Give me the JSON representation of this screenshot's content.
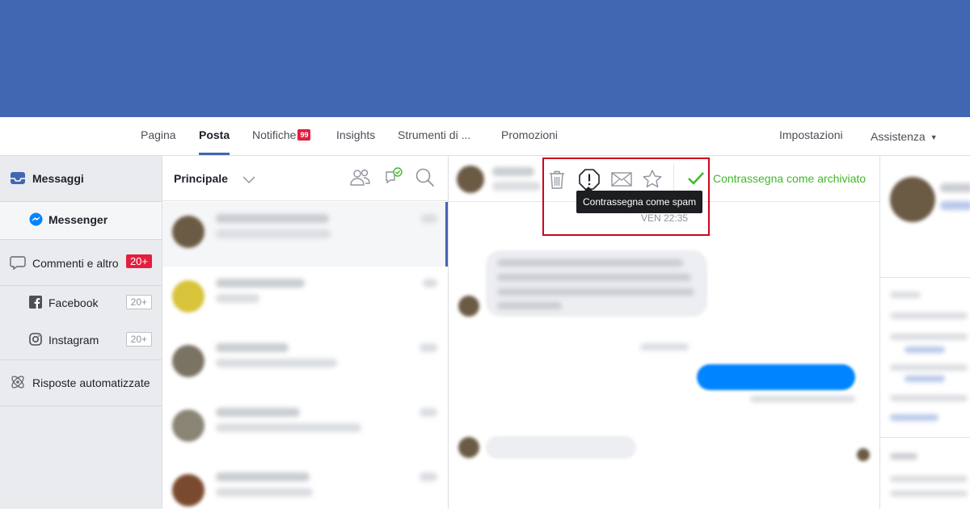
{
  "nav": {
    "tabs": [
      {
        "label": "Pagina"
      },
      {
        "label": "Posta"
      },
      {
        "label": "Notifiche",
        "badge": "99"
      },
      {
        "label": "Insights"
      },
      {
        "label": "Strumenti di ..."
      },
      {
        "label": "Promozioni"
      }
    ],
    "settings": "Impostazioni",
    "help": "Assistenza",
    "help_caret": "▼"
  },
  "sidebar": {
    "messages": "Messaggi",
    "messenger": "Messenger",
    "comments": "Commenti e altro",
    "comments_count": "20+",
    "facebook": "Facebook",
    "facebook_count": "20+",
    "instagram": "Instagram",
    "instagram_count": "20+",
    "auto_replies": "Risposte automatizzate"
  },
  "inbox": {
    "filter_label": "Principale"
  },
  "conversation": {
    "actions": {
      "delete": "trash-icon",
      "spam": "spam-icon",
      "unread": "mail-icon",
      "star": "star-icon",
      "archive_label": "Contrassegna come archiviato"
    },
    "tooltip": "Contrassegna come spam",
    "timestamp": "VEN 22:35"
  },
  "colors": {
    "brand": "#4267b2",
    "archive": "#42b72a",
    "badge": "#e41e3f",
    "highlight": "#d0021b"
  }
}
